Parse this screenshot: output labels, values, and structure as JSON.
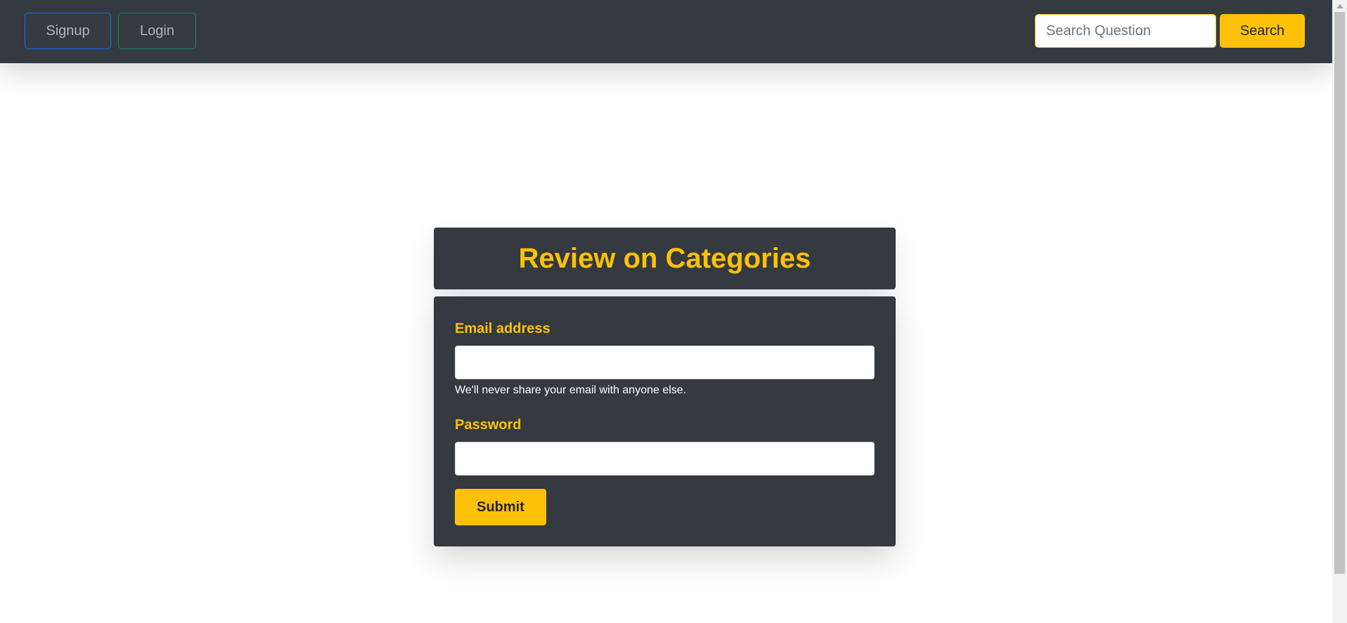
{
  "nav": {
    "signup_label": "Signup",
    "login_label": "Login",
    "search_placeholder": "Search Question",
    "search_value": "",
    "search_button_label": "Search"
  },
  "card": {
    "title": "Review on Categories"
  },
  "form": {
    "email_label": "Email address",
    "email_value": "",
    "email_help": "We'll never share your email with anyone else.",
    "password_label": "Password",
    "password_value": "",
    "submit_label": "Submit"
  },
  "colors": {
    "navbar_bg": "#343a40",
    "accent_yellow": "#ffc107",
    "signup_border": "#0d6efd",
    "login_border": "#198754",
    "card_bg": "#343a40"
  }
}
